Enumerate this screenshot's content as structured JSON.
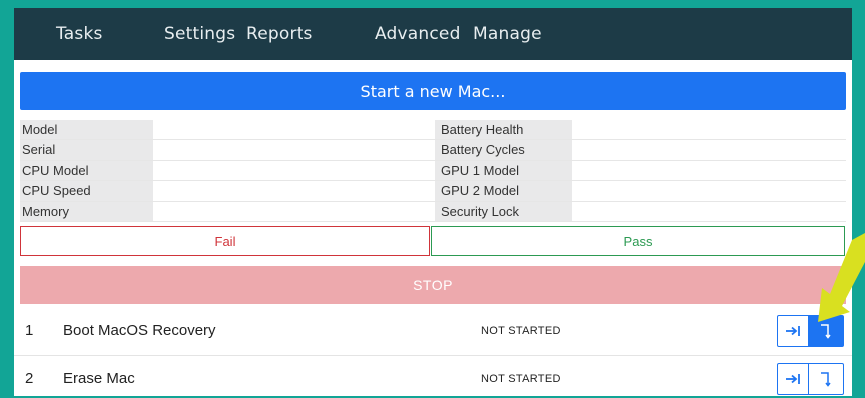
{
  "nav": {
    "items": [
      {
        "label": "Tasks"
      },
      {
        "label": "Settings"
      },
      {
        "label": "Reports"
      },
      {
        "label": "Advanced"
      },
      {
        "label": "Manage"
      }
    ]
  },
  "start_button_label": "Start a new Mac...",
  "info": {
    "rows": [
      {
        "left_label": "Model",
        "left_value": "",
        "right_label": "Battery Health",
        "right_value": ""
      },
      {
        "left_label": "Serial",
        "left_value": "",
        "right_label": "Battery Cycles",
        "right_value": ""
      },
      {
        "left_label": "CPU Model",
        "left_value": "",
        "right_label": "GPU 1 Model",
        "right_value": ""
      },
      {
        "left_label": "CPU Speed",
        "left_value": "",
        "right_label": "GPU 2 Model",
        "right_value": ""
      },
      {
        "left_label": "Memory",
        "left_value": "",
        "right_label": "Security Lock",
        "right_value": ""
      }
    ]
  },
  "result": {
    "fail_label": "Fail",
    "pass_label": "Pass"
  },
  "stop_label": "STOP",
  "tasks": [
    {
      "number": "1",
      "name": "Boot MacOS Recovery",
      "status": "NOT STARTED",
      "run_icon": "skip-to-end-icon",
      "step_icon": "step-down-icon"
    },
    {
      "number": "2",
      "name": "Erase Mac",
      "status": "NOT STARTED",
      "run_icon": "skip-to-end-icon",
      "step_icon": "step-down-icon"
    }
  ],
  "colors": {
    "nav_bg": "#1d3b47",
    "primary": "#1d74f2",
    "fail": "#d0343a",
    "pass": "#2c9a52",
    "stop": "#eda9ad",
    "annotation": "#d9e020"
  }
}
